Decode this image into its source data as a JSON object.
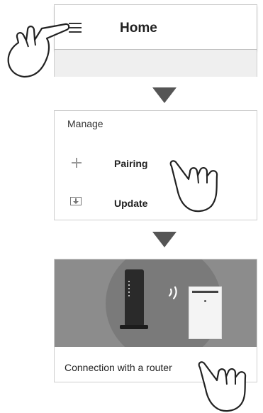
{
  "home_screen": {
    "title": "Home",
    "menu_icon": "hamburger-menu-icon"
  },
  "manage_menu": {
    "heading": "Manage",
    "items": [
      {
        "icon": "plus-icon",
        "label": "Pairing"
      },
      {
        "icon": "update-icon",
        "label": "Update"
      }
    ]
  },
  "router_screen": {
    "caption": "Connection with a router",
    "illustration_icons": [
      "router-icon",
      "wifi-signal-icon",
      "air-purifier-icon"
    ]
  },
  "gesture_icons": [
    "tap-hand-icon",
    "tap-hand-icon",
    "tap-hand-icon"
  ],
  "colors": {
    "banner": "#8c8c8c",
    "arrow": "#555555",
    "appbar_under": "#efefef"
  }
}
